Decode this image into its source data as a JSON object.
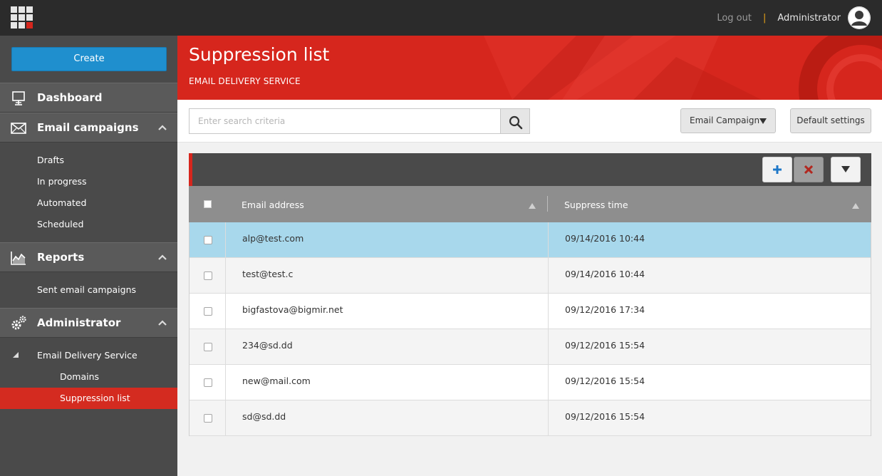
{
  "topbar": {
    "logout_label": "Log out",
    "separator": "|",
    "user_name": "Administrator"
  },
  "sidebar": {
    "create_label": "Create",
    "sections": [
      {
        "title": "Dashboard",
        "icon": "dashboard-icon"
      },
      {
        "title": "Email campaigns",
        "icon": "envelope-icon",
        "items": [
          "Drafts",
          "In progress",
          "Automated",
          "Scheduled"
        ]
      },
      {
        "title": "Reports",
        "icon": "reports-chart-icon",
        "items": [
          "Sent email campaigns"
        ]
      },
      {
        "title": "Administrator",
        "icon": "gears-icon",
        "items": [
          "Email Delivery Service",
          "Domains",
          "Suppression list"
        ]
      }
    ],
    "active_item": "Suppression list"
  },
  "banner": {
    "title": "Suppression list",
    "subtitle": "EMAIL DELIVERY SERVICE"
  },
  "filters": {
    "search_placeholder": "Enter search criteria",
    "campaign_select": "Email Campaign",
    "default_settings_label": "Default settings"
  },
  "grid": {
    "columns": [
      "Email address",
      "Suppress time"
    ],
    "rows": [
      {
        "email": "alp@test.com",
        "time": "09/14/2016 10:44",
        "selected": true
      },
      {
        "email": "test@test.c",
        "time": "09/14/2016 10:44"
      },
      {
        "email": "bigfastova@bigmir.net",
        "time": "09/12/2016 17:34"
      },
      {
        "email": "234@sd.dd",
        "time": "09/12/2016 15:54"
      },
      {
        "email": "new@mail.com",
        "time": "09/12/2016 15:54"
      },
      {
        "email": "sd@sd.dd",
        "time": "09/12/2016 15:54"
      }
    ]
  },
  "colors": {
    "accent_red": "#d6261d",
    "create_blue": "#1f8fce",
    "selected_row": "#a8d8ec",
    "sidebar_bg": "#4a4a4a",
    "topbar_bg": "#2b2b2b"
  }
}
